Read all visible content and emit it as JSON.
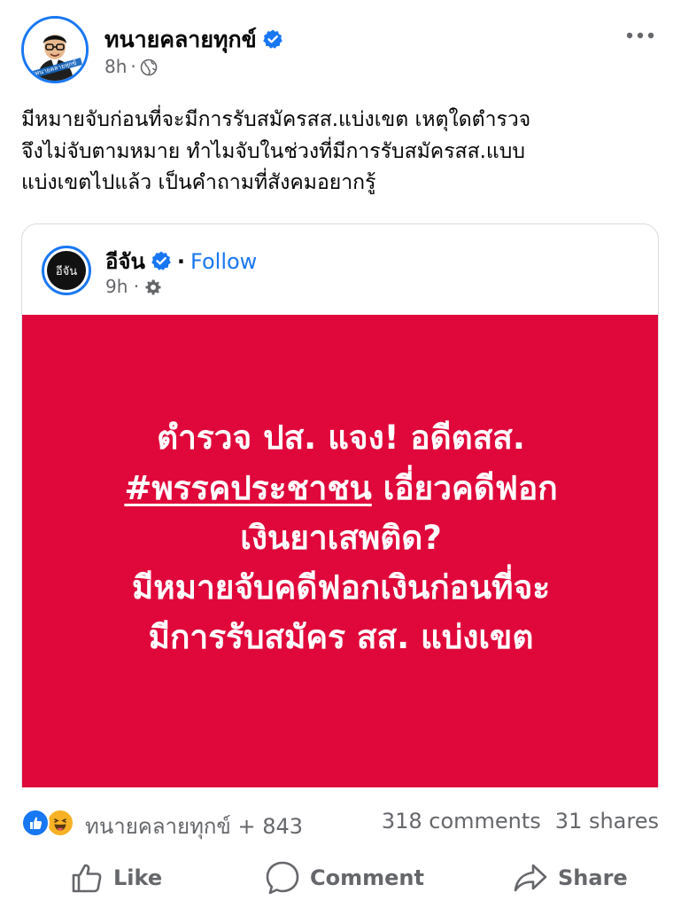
{
  "post": {
    "author": "ทนายคลายทุกข์",
    "author_verified": true,
    "time": "8h",
    "audience_icon": "globe-icon",
    "more_icon": "more-horizontal-icon",
    "text_lines": [
      "มีหมายจับก่อนที่จะมีการรับสมัครสส.แบ่งเขต เหตุใดตำรวจ",
      "จึงไม่จับตามหมาย ทำไมจับในช่วงที่มีการรับสมัครสส.แบบ",
      "แบ่งเขตไปแล้ว เป็นคำถามที่สังคมอยากรู้"
    ],
    "avatar_badge_text": "ทนายคลายทุกข์"
  },
  "shared": {
    "author": "อีจัน",
    "avatar_text": "อีจัน",
    "author_verified": true,
    "follow_label": "Follow",
    "time": "9h",
    "audience_icon": "gear-icon",
    "image": {
      "background": "#e0083b",
      "line1": "ตำรวจ ปส. แจง! อดีตสส.",
      "hashtag": "#พรรคประชาชน",
      "line2_rest": " เอี่ยวคดีฟอก",
      "line3": "เงินยาเสพติด?",
      "line4": "มีหมายจับคดีฟอกเงินก่อนที่จะ",
      "line5": "มีการรับสมัคร สส. แบ่งเขต"
    }
  },
  "reactions": {
    "icons": [
      "like-reaction-icon",
      "haha-reaction-icon"
    ],
    "summary": "ทนายคลายทุกข์ + 843",
    "comments": "318 comments",
    "shares": "31 shares"
  },
  "actions": {
    "like": "Like",
    "comment": "Comment",
    "share": "Share"
  },
  "colors": {
    "facebook_blue": "#1877f2",
    "meta_gray": "#65676b",
    "text": "#050505",
    "haha_yellow": "#f7b125"
  }
}
